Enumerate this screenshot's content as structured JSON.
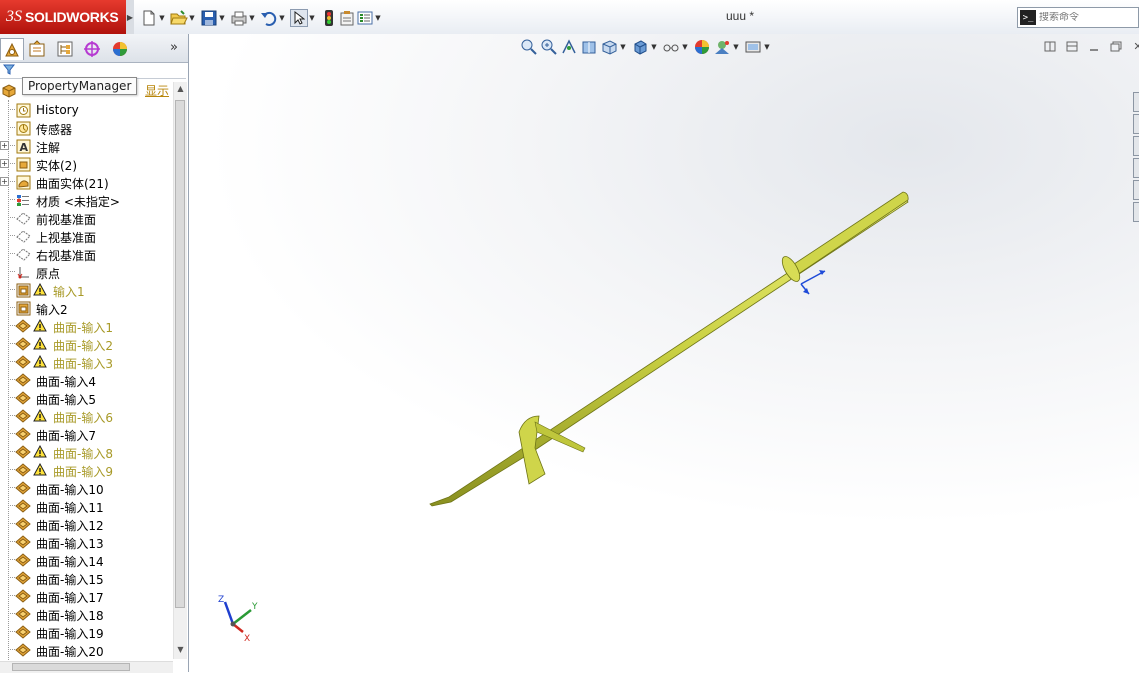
{
  "app": {
    "logo_prefix": "3S",
    "logo_text": "SOLIDWORKS",
    "document_title": "uuu *"
  },
  "search": {
    "placeholder": "搜索命令",
    "icon": "terminal-icon"
  },
  "quick_toolbar": [
    {
      "name": "new-document",
      "icon": "new-doc-icon"
    },
    {
      "name": "open",
      "icon": "open-folder-icon"
    },
    {
      "name": "save",
      "icon": "save-icon"
    },
    {
      "name": "print",
      "icon": "print-icon"
    },
    {
      "name": "undo",
      "icon": "undo-icon"
    },
    {
      "name": "select",
      "icon": "cursor-icon"
    },
    {
      "name": "rebuild",
      "icon": "traffic-light-icon"
    },
    {
      "name": "file-properties",
      "icon": "clipboard-icon"
    },
    {
      "name": "options",
      "icon": "options-icon"
    }
  ],
  "manager": {
    "tooltip": "PropertyManager",
    "show_label": "显示",
    "more": "»",
    "tabs": [
      "feature-manager",
      "property-manager",
      "configuration-manager",
      "dimxpert-manager",
      "display-manager"
    ]
  },
  "tree": {
    "items": [
      {
        "label": "History",
        "icon": "history-icon",
        "expandable": false,
        "warning": false
      },
      {
        "label": "传感器",
        "icon": "sensor-icon",
        "expandable": false,
        "warning": false
      },
      {
        "label": "注解",
        "icon": "annotation-icon",
        "expandable": true,
        "warning": false
      },
      {
        "label": "实体(2)",
        "icon": "solid-body-icon",
        "expandable": true,
        "warning": false
      },
      {
        "label": "曲面实体(21)",
        "icon": "surface-body-icon",
        "expandable": true,
        "warning": false
      },
      {
        "label": "材质 <未指定>",
        "icon": "material-icon",
        "expandable": false,
        "warning": false
      },
      {
        "label": "前视基准面",
        "icon": "plane-icon",
        "expandable": false,
        "warning": false
      },
      {
        "label": "上视基准面",
        "icon": "plane-icon",
        "expandable": false,
        "warning": false
      },
      {
        "label": "右视基准面",
        "icon": "plane-icon",
        "expandable": false,
        "warning": false
      },
      {
        "label": "原点",
        "icon": "origin-icon",
        "expandable": false,
        "warning": false
      },
      {
        "label": "输入1",
        "icon": "import-icon",
        "expandable": false,
        "warning": true
      },
      {
        "label": "输入2",
        "icon": "import-icon",
        "expandable": false,
        "warning": false
      },
      {
        "label": "曲面-输入1",
        "icon": "surface-import-icon",
        "expandable": false,
        "warning": true
      },
      {
        "label": "曲面-输入2",
        "icon": "surface-import-icon",
        "expandable": false,
        "warning": true
      },
      {
        "label": "曲面-输入3",
        "icon": "surface-import-icon",
        "expandable": false,
        "warning": true
      },
      {
        "label": "曲面-输入4",
        "icon": "surface-import-icon",
        "expandable": false,
        "warning": false
      },
      {
        "label": "曲面-输入5",
        "icon": "surface-import-icon",
        "expandable": false,
        "warning": false
      },
      {
        "label": "曲面-输入6",
        "icon": "surface-import-icon",
        "expandable": false,
        "warning": true
      },
      {
        "label": "曲面-输入7",
        "icon": "surface-import-icon",
        "expandable": false,
        "warning": false
      },
      {
        "label": "曲面-输入8",
        "icon": "surface-import-icon",
        "expandable": false,
        "warning": true
      },
      {
        "label": "曲面-输入9",
        "icon": "surface-import-icon",
        "expandable": false,
        "warning": true
      },
      {
        "label": "曲面-输入10",
        "icon": "surface-import-icon",
        "expandable": false,
        "warning": false
      },
      {
        "label": "曲面-输入11",
        "icon": "surface-import-icon",
        "expandable": false,
        "warning": false
      },
      {
        "label": "曲面-输入12",
        "icon": "surface-import-icon",
        "expandable": false,
        "warning": false
      },
      {
        "label": "曲面-输入13",
        "icon": "surface-import-icon",
        "expandable": false,
        "warning": false
      },
      {
        "label": "曲面-输入14",
        "icon": "surface-import-icon",
        "expandable": false,
        "warning": false
      },
      {
        "label": "曲面-输入15",
        "icon": "surface-import-icon",
        "expandable": false,
        "warning": false
      },
      {
        "label": "曲面-输入17",
        "icon": "surface-import-icon",
        "expandable": false,
        "warning": false
      },
      {
        "label": "曲面-输入18",
        "icon": "surface-import-icon",
        "expandable": false,
        "warning": false
      },
      {
        "label": "曲面-输入19",
        "icon": "surface-import-icon",
        "expandable": false,
        "warning": false
      },
      {
        "label": "曲面-输入20",
        "icon": "surface-import-icon",
        "expandable": false,
        "warning": false
      }
    ]
  },
  "heads_up_toolbar": [
    {
      "name": "zoom-to-fit",
      "icon": "zoom-fit-icon"
    },
    {
      "name": "zoom-to-area",
      "icon": "zoom-area-icon"
    },
    {
      "name": "previous-view",
      "icon": "previous-view-icon"
    },
    {
      "name": "section-view",
      "icon": "section-view-icon"
    },
    {
      "name": "view-orientation",
      "icon": "view-orientation-icon"
    },
    {
      "name": "display-style",
      "icon": "display-style-icon"
    },
    {
      "name": "hide-show-items",
      "icon": "hide-show-icon"
    },
    {
      "name": "edit-appearance",
      "icon": "appearance-icon"
    },
    {
      "name": "apply-scene",
      "icon": "scene-icon"
    },
    {
      "name": "view-settings",
      "icon": "view-settings-icon"
    }
  ],
  "triad": {
    "x": "X",
    "y": "Y",
    "z": "Z"
  },
  "colors": {
    "brand_red": "#c8231b",
    "model_yellow": "#c9d042",
    "warning_text": "#a89a28",
    "link_show": "#b8860b"
  }
}
